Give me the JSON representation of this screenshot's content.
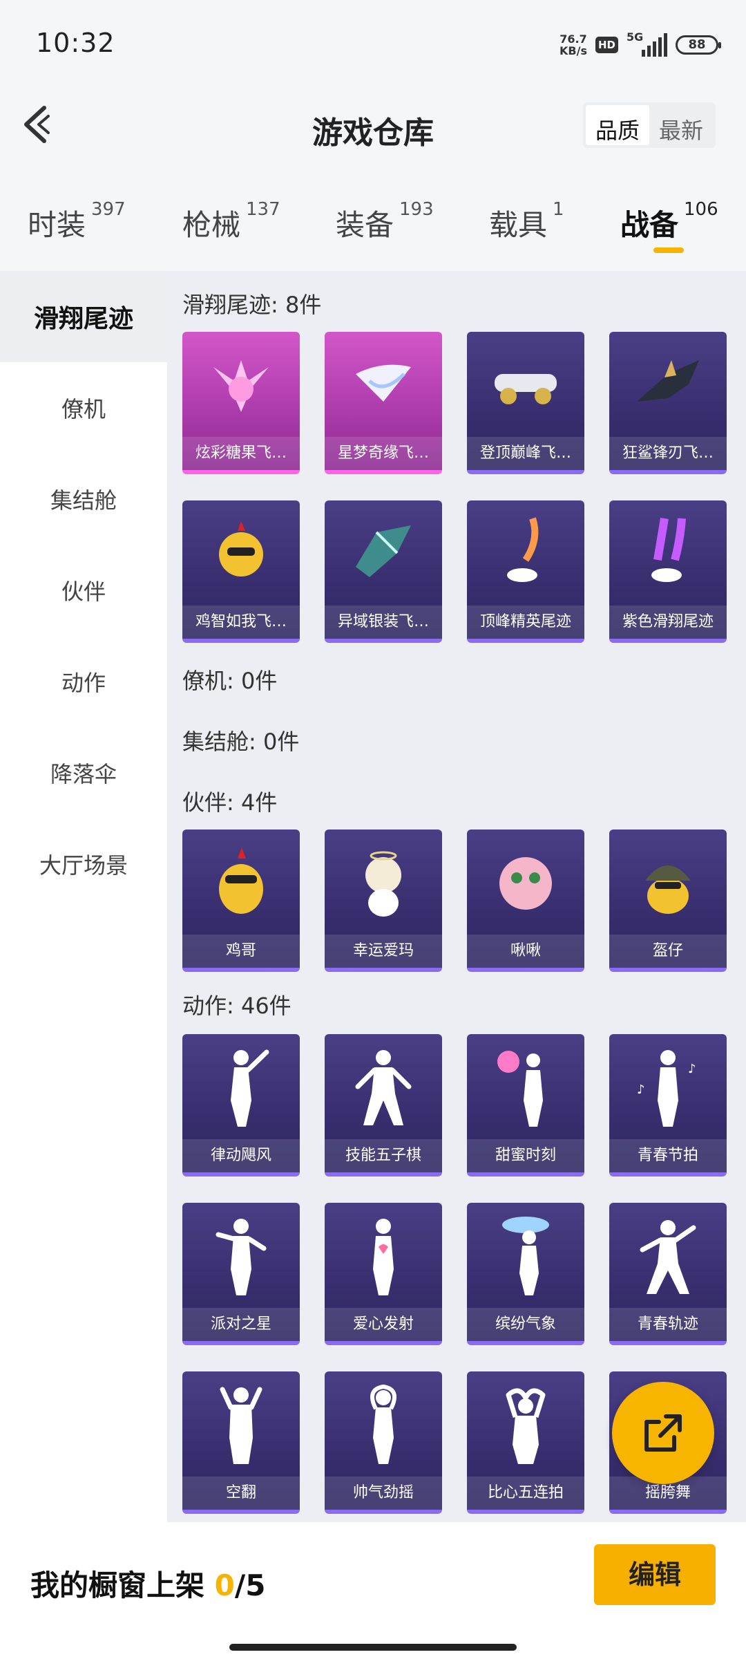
{
  "status_bar": {
    "time": "10:32",
    "net_speed": "76.7",
    "net_unit": "KB/s",
    "hd": "HD",
    "signal": "5G",
    "battery": "88"
  },
  "header": {
    "title": "游戏仓库",
    "sort_quality": "品质",
    "sort_latest": "最新"
  },
  "tabs": [
    {
      "label": "时装",
      "count": "397"
    },
    {
      "label": "枪械",
      "count": "137"
    },
    {
      "label": "装备",
      "count": "193"
    },
    {
      "label": "载具",
      "count": "1"
    },
    {
      "label": "战备",
      "count": "106"
    }
  ],
  "sidebar": [
    "滑翔尾迹",
    "僚机",
    "集结舱",
    "伙伴",
    "动作",
    "降落伞",
    "大厅场景"
  ],
  "sections": {
    "glide": {
      "title": "滑翔尾迹: 8件",
      "items": [
        "炫彩糖果飞…",
        "星梦奇缘飞…",
        "登顶巅峰飞…",
        "狂鲨锋刃飞…",
        "鸡智如我飞…",
        "异域银装飞…",
        "顶峰精英尾迹",
        "紫色滑翔尾迹"
      ]
    },
    "wingman": {
      "title": "僚机: 0件"
    },
    "pod": {
      "title": "集结舱: 0件"
    },
    "partner": {
      "title": "伙伴: 4件",
      "items": [
        "鸡哥",
        "幸运爱玛",
        "啾啾",
        "盔仔"
      ]
    },
    "emote": {
      "title": "动作: 46件",
      "items": [
        "律动飓风",
        "技能五子棋",
        "甜蜜时刻",
        "青春节拍",
        "派对之星",
        "爱心发射",
        "缤纷气象",
        "青春轨迹",
        "空翻",
        "帅气劲摇",
        "比心五连拍",
        "摇胯舞"
      ]
    }
  },
  "bottom": {
    "showcase_label": "我的橱窗上架",
    "count_current": "0",
    "count_sep": "/",
    "count_total": "5",
    "edit_button": "编辑"
  },
  "colors": {
    "accent": "#f6b400",
    "card_purple": "#3a2f70",
    "card_pink": "#b23fb0"
  }
}
